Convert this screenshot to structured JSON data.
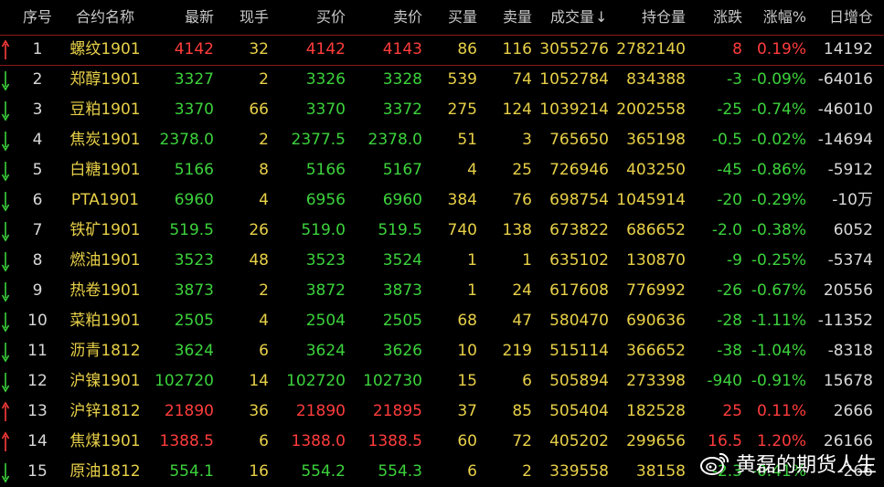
{
  "colors": {
    "up": "#ff3c3c",
    "down": "#3cd23c",
    "text": "#d8d8d8",
    "name": "#e8d048",
    "divider": "#8a1a1a"
  },
  "headers": {
    "seq": "序号",
    "name": "合约名称",
    "last": "最新",
    "cur": "现手",
    "bid": "买价",
    "ask": "卖价",
    "bidvol": "买量",
    "askvol": "卖量",
    "volume": "成交量",
    "sort_icon": "↓",
    "oi": "持仓量",
    "chg": "涨跌",
    "pct": "涨幅%",
    "oichg": "日增仓"
  },
  "rows": [
    {
      "dir": "up",
      "seq": "1",
      "name": "螺纹1901",
      "last": "4142",
      "cur": "32",
      "bid": "4142",
      "ask": "4143",
      "bidvol": "86",
      "askvol": "116",
      "volume": "3055276",
      "oi": "2782140",
      "chg": "8",
      "pct": "0.19%",
      "oichg": "14192"
    },
    {
      "dir": "down",
      "seq": "2",
      "name": "郑醇1901",
      "last": "3327",
      "cur": "2",
      "bid": "3326",
      "ask": "3328",
      "bidvol": "539",
      "askvol": "74",
      "volume": "1052784",
      "oi": "834388",
      "chg": "-3",
      "pct": "-0.09%",
      "oichg": "-64016"
    },
    {
      "dir": "down",
      "seq": "3",
      "name": "豆粕1901",
      "last": "3370",
      "cur": "66",
      "bid": "3370",
      "ask": "3372",
      "bidvol": "275",
      "askvol": "124",
      "volume": "1039214",
      "oi": "2002558",
      "chg": "-25",
      "pct": "-0.74%",
      "oichg": "-46010"
    },
    {
      "dir": "down",
      "seq": "4",
      "name": "焦炭1901",
      "last": "2378.0",
      "cur": "2",
      "bid": "2377.5",
      "ask": "2378.0",
      "bidvol": "51",
      "askvol": "3",
      "volume": "765650",
      "oi": "365198",
      "chg": "-0.5",
      "pct": "-0.02%",
      "oichg": "-14694"
    },
    {
      "dir": "down",
      "seq": "5",
      "name": "白糖1901",
      "last": "5166",
      "cur": "8",
      "bid": "5166",
      "ask": "5167",
      "bidvol": "4",
      "askvol": "25",
      "volume": "726946",
      "oi": "403250",
      "chg": "-45",
      "pct": "-0.86%",
      "oichg": "-5912"
    },
    {
      "dir": "down",
      "seq": "6",
      "name": "PTA1901",
      "last": "6960",
      "cur": "4",
      "bid": "6956",
      "ask": "6960",
      "bidvol": "384",
      "askvol": "76",
      "volume": "698754",
      "oi": "1045914",
      "chg": "-20",
      "pct": "-0.29%",
      "oichg": "-10万"
    },
    {
      "dir": "down",
      "seq": "7",
      "name": "铁矿1901",
      "last": "519.5",
      "cur": "26",
      "bid": "519.0",
      "ask": "519.5",
      "bidvol": "740",
      "askvol": "138",
      "volume": "673822",
      "oi": "686652",
      "chg": "-2.0",
      "pct": "-0.38%",
      "oichg": "6052"
    },
    {
      "dir": "down",
      "seq": "8",
      "name": "燃油1901",
      "last": "3523",
      "cur": "48",
      "bid": "3523",
      "ask": "3524",
      "bidvol": "1",
      "askvol": "1",
      "volume": "635102",
      "oi": "130870",
      "chg": "-9",
      "pct": "-0.25%",
      "oichg": "-5374"
    },
    {
      "dir": "down",
      "seq": "9",
      "name": "热卷1901",
      "last": "3873",
      "cur": "2",
      "bid": "3872",
      "ask": "3873",
      "bidvol": "1",
      "askvol": "24",
      "volume": "617608",
      "oi": "776992",
      "chg": "-26",
      "pct": "-0.67%",
      "oichg": "20556"
    },
    {
      "dir": "down",
      "seq": "10",
      "name": "菜粕1901",
      "last": "2505",
      "cur": "4",
      "bid": "2504",
      "ask": "2505",
      "bidvol": "68",
      "askvol": "47",
      "volume": "580470",
      "oi": "690636",
      "chg": "-28",
      "pct": "-1.11%",
      "oichg": "-11352"
    },
    {
      "dir": "down",
      "seq": "11",
      "name": "沥青1812",
      "last": "3624",
      "cur": "6",
      "bid": "3624",
      "ask": "3626",
      "bidvol": "10",
      "askvol": "219",
      "volume": "515114",
      "oi": "366652",
      "chg": "-38",
      "pct": "-1.04%",
      "oichg": "-8318"
    },
    {
      "dir": "down",
      "seq": "12",
      "name": "沪镍1901",
      "last": "102720",
      "cur": "14",
      "bid": "102720",
      "ask": "102730",
      "bidvol": "15",
      "askvol": "6",
      "volume": "505894",
      "oi": "273398",
      "chg": "-940",
      "pct": "-0.91%",
      "oichg": "15678"
    },
    {
      "dir": "up",
      "seq": "13",
      "name": "沪锌1812",
      "last": "21890",
      "cur": "36",
      "bid": "21890",
      "ask": "21895",
      "bidvol": "37",
      "askvol": "85",
      "volume": "505404",
      "oi": "182528",
      "chg": "25",
      "pct": "0.11%",
      "oichg": "2666"
    },
    {
      "dir": "up",
      "seq": "14",
      "name": "焦煤1901",
      "last": "1388.5",
      "cur": "6",
      "bid": "1388.0",
      "ask": "1388.5",
      "bidvol": "60",
      "askvol": "72",
      "volume": "405202",
      "oi": "299656",
      "chg": "16.5",
      "pct": "1.20%",
      "oichg": "26166"
    },
    {
      "dir": "down",
      "seq": "15",
      "name": "原油1812",
      "last": "554.1",
      "cur": "16",
      "bid": "554.2",
      "ask": "554.3",
      "bidvol": "6",
      "askvol": "2",
      "volume": "339558",
      "oi": "38158",
      "chg": "-2.3",
      "pct": "-0.41%",
      "oichg": "-266"
    }
  ],
  "watermark": {
    "icon": "weibo-icon",
    "text": "黄磊的期货人生"
  }
}
